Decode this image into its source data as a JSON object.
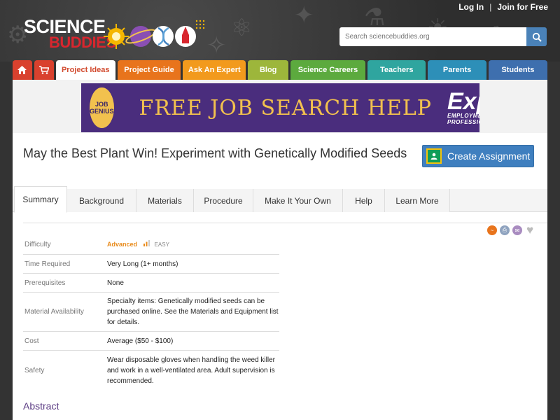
{
  "header": {
    "login": "Log In",
    "separator": "|",
    "join": "Join for Free",
    "logo_top": "SCIENCE",
    "logo_bottom": "BUDDIES",
    "search_placeholder": "Search sciencebuddies.org"
  },
  "nav": [
    {
      "label": "",
      "icon": "home-icon",
      "color": "#d9412e"
    },
    {
      "label": "",
      "icon": "cart-icon",
      "color": "#d9412e"
    },
    {
      "label": "Project Ideas",
      "color": "#ffffff"
    },
    {
      "label": "Project Guide",
      "color": "#e8741c"
    },
    {
      "label": "Ask An Expert",
      "color": "#f29a1d"
    },
    {
      "label": "Blog",
      "color": "#9db63b"
    },
    {
      "label": "Science Careers",
      "color": "#5caa3e"
    },
    {
      "label": "Teachers",
      "color": "#2fa59f"
    },
    {
      "label": "Parents",
      "color": "#2d8fb8"
    },
    {
      "label": "Students",
      "color": "#3e6fae"
    }
  ],
  "banner": {
    "circle_line1": "JOB",
    "circle_line2": "GENIUS",
    "headline": "FREE JOB SEARCH HELP",
    "brand": "Express",
    "brand_sub": "EMPLOYMENT PROFESSIONALS"
  },
  "page": {
    "title": "May the Best Plant Win! Experiment with Genetically Modified Seeds",
    "create_assignment": "Create Assignment"
  },
  "tabs": [
    "Summary",
    "Background",
    "Materials",
    "Procedure",
    "Make It Your Own",
    "Help",
    "Learn More"
  ],
  "summary": {
    "difficulty_label": "Difficulty",
    "difficulty_value": "Advanced",
    "difficulty_scale": "EASY",
    "time_label": "Time Required",
    "time_value": "Very Long (1+ months)",
    "prereq_label": "Prerequisites",
    "prereq_value": "None",
    "material_label": "Material Availability",
    "material_value": "Specialty items: Genetically modified seeds can be purchased online. See the Materials and Equipment list for details.",
    "cost_label": "Cost",
    "cost_value": "Average ($50 - $100)",
    "safety_label": "Safety",
    "safety_value": "Wear disposable gloves when handling the weed killer and work in a well-ventilated area. Adult supervision is recommended."
  },
  "abstract_heading": "Abstract",
  "colors": {
    "accent_blue": "#3f7fbf",
    "active_tab_text": "#d24a2e",
    "difficulty": "#e88a1a",
    "abstract": "#5a3a82"
  }
}
